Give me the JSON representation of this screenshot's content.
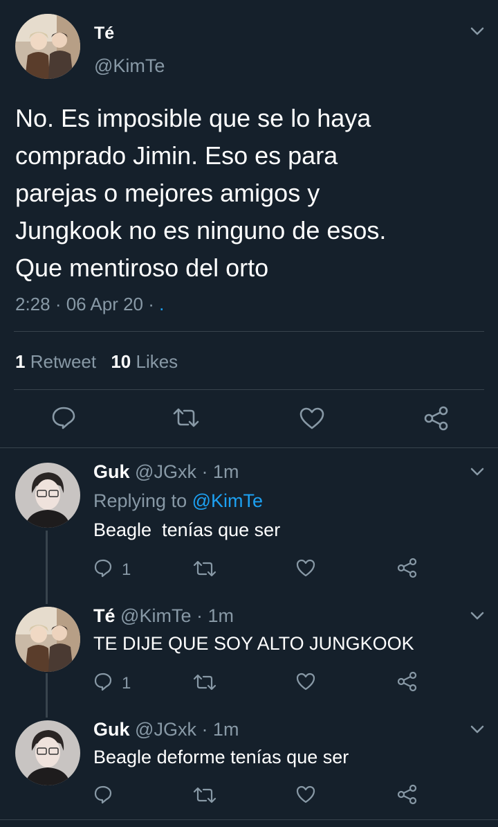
{
  "main_tweet": {
    "display_name": "Té",
    "handle": "@KimTe",
    "text_lines": [
      "No. Es imposible que se lo haya",
      "comprado Jimin. Eso es para",
      "parejas o mejores amigos y",
      "Jungkook no es ninguno de esos.",
      "Que mentiroso del orto"
    ],
    "meta": "2:28 · 06 Apr 20 ·",
    "meta_dot": ".",
    "retweets_count": "1",
    "retweets_label": "Retweet",
    "likes_count": "10",
    "likes_label": "Likes"
  },
  "replies": [
    {
      "display_name": "Guk",
      "handle_time": "@JGxk · 1m",
      "replying_prefix": "Replying to",
      "replying_to": "@KimTe",
      "text": "Beagle  tenías que ser",
      "reply_count": "1"
    },
    {
      "display_name": "Té",
      "handle_time": "@KimTe · 1m",
      "text": "TE DIJE QUE SOY ALTO JUNGKOOK",
      "reply_count": "1"
    },
    {
      "display_name": "Guk",
      "handle_time": "@JGxk · 1m",
      "text": "Beagle deforme tenías que ser",
      "reply_count": ""
    }
  ],
  "colors": {
    "background": "#15202b",
    "text": "#ffffff",
    "muted": "#8899a6",
    "link": "#1da1f2",
    "divider": "#38444d"
  }
}
